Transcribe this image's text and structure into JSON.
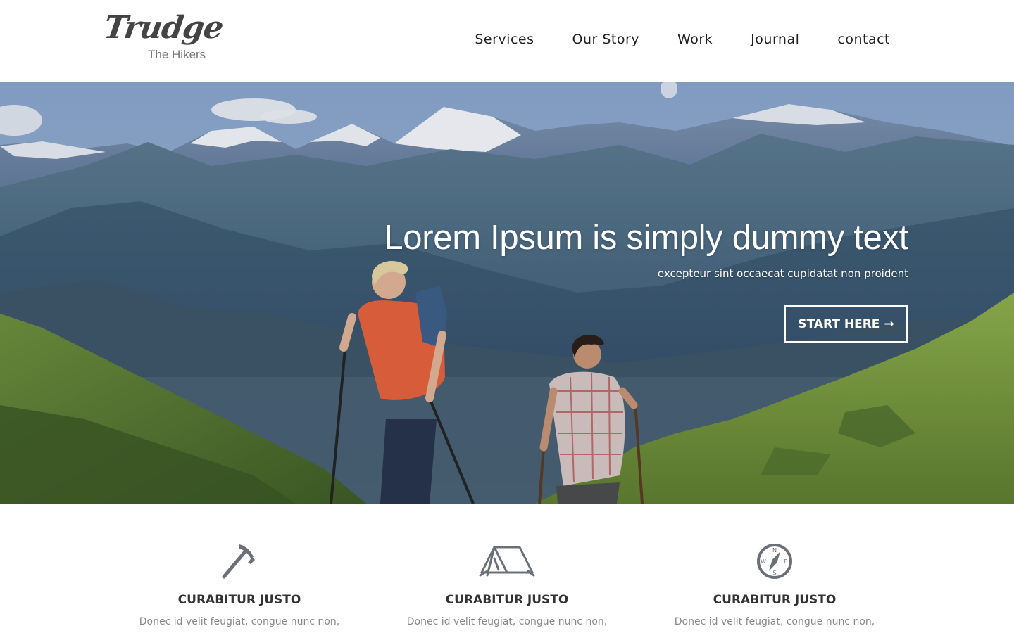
{
  "header": {
    "logo_script": "Trudge",
    "logo_tagline": "The Hikers",
    "nav": [
      "Services",
      "Our Story",
      "Work",
      "Journal",
      "contact"
    ]
  },
  "hero": {
    "title": "Lorem Ipsum is simply dummy text",
    "subtitle": "excepteur sint occaecat cupidatat non proident",
    "cta_label": "START HERE",
    "cta_arrow": "→"
  },
  "features": [
    {
      "icon": "ice-axe-icon",
      "title": "CURABITUR JUSTO",
      "text": "Donec id velit feugiat, congue nunc non,"
    },
    {
      "icon": "tent-icon",
      "title": "CURABITUR JUSTO",
      "text": "Donec id velit feugiat, congue nunc non,"
    },
    {
      "icon": "compass-icon",
      "title": "CURABITUR JUSTO",
      "text": "Donec id velit feugiat, congue nunc non,"
    }
  ],
  "colors": {
    "text_dark": "#222222",
    "icon_gray": "#6b7078",
    "muted_text": "#888888",
    "white": "#ffffff"
  }
}
